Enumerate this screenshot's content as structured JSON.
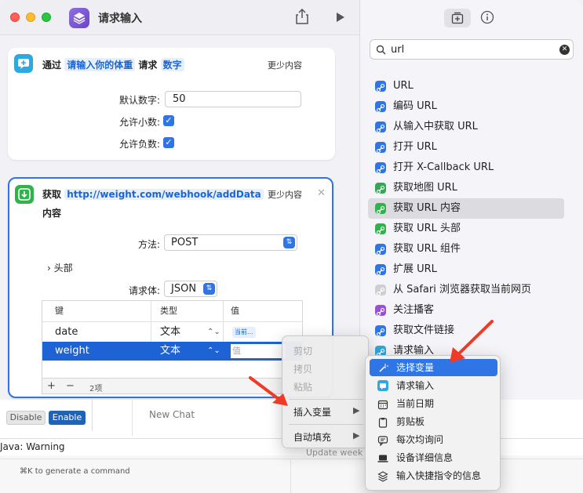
{
  "window": {
    "title": "请求输入"
  },
  "card1": {
    "prefix": "通过",
    "prompt_chip": "请输入你的体重",
    "verb": "请求",
    "type_chip": "数字",
    "more": "更少内容",
    "default_label": "默认数字:",
    "default_value": "50",
    "decimals_label": "允许小数:",
    "negatives_label": "允许负数:"
  },
  "card2": {
    "prefix": "获取",
    "url_chip": "http://weight.com/webhook/addData",
    "suffix": "内容",
    "more": "更少内容",
    "method_label": "方法:",
    "method_value": "POST",
    "headers_label": "头部",
    "body_label": "请求体:",
    "body_value": "JSON",
    "table": {
      "headers": [
        "键",
        "类型",
        "值"
      ],
      "rows": [
        {
          "key": "date",
          "type": "文本",
          "value": "当前..."
        },
        {
          "key": "weight",
          "type": "文本",
          "value": "值"
        }
      ],
      "footer_add": "+",
      "footer_remove": "−",
      "footer_count": "2项"
    }
  },
  "context_menu": {
    "cut": "剪切",
    "copy": "拷贝",
    "paste": "粘贴",
    "insert_variable": "插入变量",
    "autofill": "自动填充"
  },
  "submenu": {
    "items": [
      "选择变量",
      "请求输入",
      "当前日期",
      "剪贴板",
      "每次均询问",
      "设备详细信息",
      "输入快捷指令的信息"
    ]
  },
  "sidebar": {
    "search_value": "url",
    "items": [
      {
        "label": "URL",
        "color": "#2f75e6"
      },
      {
        "label": "编码 URL",
        "color": "#2f75e6"
      },
      {
        "label": "从输入中获取 URL",
        "color": "#2f75e6"
      },
      {
        "label": "打开 URL",
        "color": "#2f75e6"
      },
      {
        "label": "打开 X-Callback URL",
        "color": "#2f75e6"
      },
      {
        "label": "获取地图 URL",
        "color": "#34a853"
      },
      {
        "label": "获取 URL 内容",
        "color": "#30b34a"
      },
      {
        "label": "获取 URL 头部",
        "color": "#30b34a"
      },
      {
        "label": "获取 URL 组件",
        "color": "#2f75e6"
      },
      {
        "label": "扩展 URL",
        "color": "#2f75e6"
      },
      {
        "label": "从 Safari 浏览器获取当前网页",
        "color": "#cfcfcf"
      },
      {
        "label": "关注播客",
        "color": "#9b4fd6"
      },
      {
        "label": "获取文件链接",
        "color": "#2f75e6"
      },
      {
        "label": "请求输入",
        "color": "#2ea8e0"
      }
    ]
  },
  "background_app": {
    "disable": "Disable",
    "enable": "Enable",
    "new_chat": "New Chat",
    "warning": "Java: Warning",
    "update": "Update week",
    "cmd_hint": "⌘K to generate a command"
  }
}
